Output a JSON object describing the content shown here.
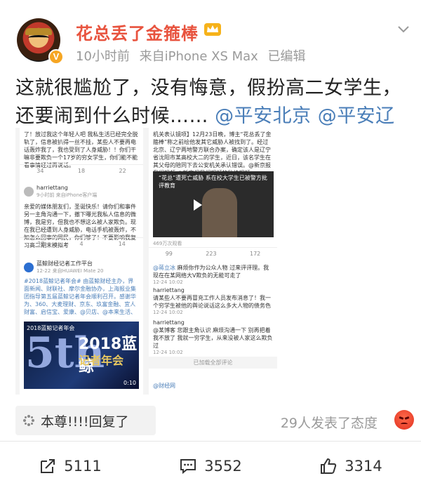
{
  "post": {
    "username": "花总丢了金箍棒",
    "verified_badge": "V",
    "time": "10小时前",
    "source": "来自iPhone XS Max",
    "edited": "已编辑",
    "text_main": "这就很尴尬了，没有悔意，假扮高二女学生，还要闹到什么时候……",
    "mention1": "@平安北京",
    "mention2": "@平安辽宁"
  },
  "screenshot": {
    "left_top_text": "了！放过我这个年轻人吧 我私生活已经完全脱轨了，信息被扒得一丝不挂，某些人不要再电话轰炸我了，我也受到了人身威胁！！你们干嘛非要欺负一个17岁的穷女学生，你们能不能看事情经过再说话。",
    "left_top_counts": [
      "34",
      "18",
      "22"
    ],
    "user2_name": "harriettang",
    "user2_meta": "9小时前 来自iPhone客户端",
    "user2_text": "亲爱的媒体朋友们，圣诞快乐！请你们和事件另一主角沟通一下，撤下曝光我私人信息的微博，我是穷，但我也不想这么被人家欺负。现在我已经遭到人身威胁，电话手机被轰炸，不知怎么回事的网民，你们够了！不要影响我复习高二期末模拟考",
    "user2_counts": [
      "37",
      "4",
      "14"
    ],
    "account3_name": "蓝鲸财经记者工作平台",
    "account3_meta": "12-22 来自HUAWEI Mate 20",
    "account3_text": "#2018蓝鲸记者年会# 由蓝鲸财经主办，界面新闻、财联社、摩尔金融协办，上海报业集团指导第五届蓝鲸记者年会顺利召开。感谢华为、360、大麦理财、京东、玖富金融、宜人财富、启信宝、爱康、@贝店、@本来生活、金蛋理财、阳光保险集团、开启人工智能体验时代的@爱康国宾，生财新零售的开拓者和领导者……全文",
    "conf_title": "2018蓝鲸",
    "conf_sub": "记者年会",
    "conf_five": "5th",
    "conf_label": "2018蓝鲸记者年会",
    "conf_duration": "0:10",
    "right_top_text": "机关表认镜项】12月23日晚，博主“花总丢了金箍棒”称之前绘他发其它威胁人被找到了。经过北京、辽宁两地警方联合办案，确定该人是辽宁省沈阳市某高校大二的学生，近日，该名学生在其父母的陪同下去公安机关承认错误。@新京报我们视频 @新京报我们视频的秒拍视频",
    "video_caption": "“花总”遭死亡威胁 系在校大学生已被警方批评教育",
    "video_views": "469万次观看",
    "right_counts": [
      "99",
      "223",
      "172"
    ],
    "c1_name": "@蒋立冰",
    "c1_text": "麻烦你作为公众人物 过来评评理。我现在在某网络大V欺负的无能可走了",
    "c1_time": "12-24 10:02",
    "c2_name": "harriettang",
    "c2_text": "请某些人不要再冒充工作人员发布消息了！我一个穷学生被他的舆论说话这么多大人物的债务色",
    "c2_time": "12-24 10:02",
    "c3_name": "harriettang",
    "c3_text": "@某博客 您跟主角认识 麻烦沟通一下 别再把着我不放了 我就一穷学生，从来没被人家这么欺负过",
    "c3_time": "12-24 10:02",
    "load_more": "已加载全部评论",
    "bottom_name": "@财经网"
  },
  "repost_strip": {
    "text": "本尊!!!!回复了",
    "reacted": "29人发表了态度"
  },
  "actions": {
    "repost_count": "5111",
    "comment_count": "3552",
    "like_count": "3314"
  },
  "colors": {
    "username": "#e8533e",
    "mention": "#4a7eb8",
    "meta": "#9a9a9a",
    "badge": "#f6a623"
  }
}
